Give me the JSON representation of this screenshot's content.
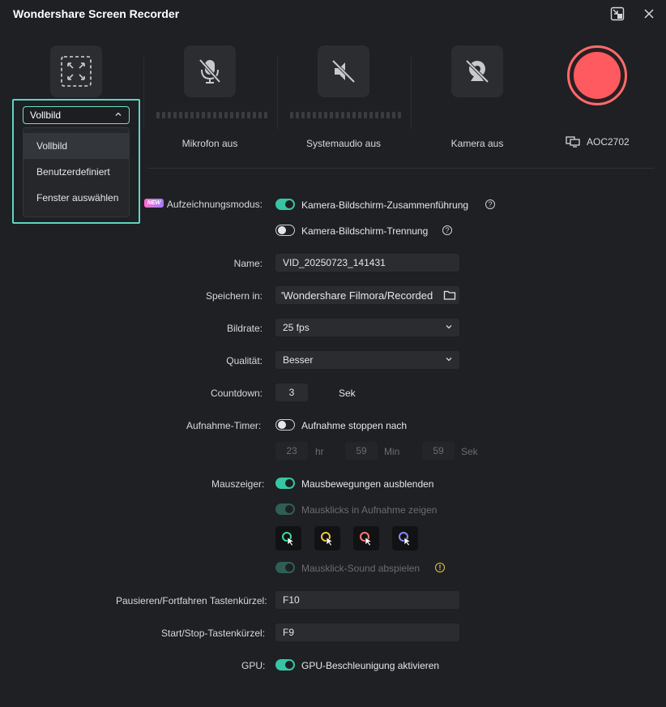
{
  "window": {
    "title": "Wondershare Screen Recorder"
  },
  "sources": {
    "screen": {
      "icon": "fullscreen-icon"
    },
    "microphone": {
      "label": "Mikrofon aus",
      "icon": "mic-off-icon"
    },
    "system_audio": {
      "label": "Systemaudio aus",
      "icon": "speaker-off-icon"
    },
    "camera": {
      "label": "Kamera aus",
      "icon": "camera-off-icon"
    },
    "monitor": {
      "label": "AOC2702",
      "icon": "monitor-icon"
    }
  },
  "area_dropdown": {
    "selected": "Vollbild",
    "options": [
      "Vollbild",
      "Benutzerdefiniert",
      "Fenster auswählen"
    ]
  },
  "settings": {
    "mode": {
      "label": "Aufzeichnungsmodus:",
      "badge": "NEW",
      "option_merge": "Kamera-Bildschirm-Zusammenführung",
      "option_split": "Kamera-Bildschirm-Trennung"
    },
    "name": {
      "label": "Name:",
      "value": "VID_20250723_141431"
    },
    "save": {
      "label": "Speichern in:",
      "value": "'Wondershare Filmora/Recorded"
    },
    "framerate": {
      "label": "Bildrate:",
      "value": "25 fps"
    },
    "quality": {
      "label": "Qualität:",
      "value": "Besser"
    },
    "countdown": {
      "label": "Countdown:",
      "value": "3",
      "unit": "Sek"
    },
    "timer": {
      "label": "Aufnahme-Timer:",
      "toggle_label": "Aufnahme stoppen nach",
      "hours": "23",
      "hours_unit": "hr",
      "minutes": "59",
      "minutes_unit": "Min",
      "seconds": "59",
      "seconds_unit": "Sek"
    },
    "pointer": {
      "label": "Mauszeiger:",
      "hide_moves": "Mausbewegungen ausblenden",
      "show_clicks": "Mausklicks in Aufnahme zeigen",
      "click_sound": "Mausklick-Sound abspielen",
      "cursor_colors": [
        "#3ddc97",
        "#f5c542",
        "#ff7a7a",
        "#8a8cff"
      ]
    },
    "pause_shortcut": {
      "label": "Pausieren/Fortfahren Tastenkürzel:",
      "value": "F10"
    },
    "start_shortcut": {
      "label": "Start/Stop-Tastenkürzel:",
      "value": "F9"
    },
    "gpu": {
      "label": "GPU:",
      "toggle_label": "GPU-Beschleunigung aktivieren"
    }
  },
  "colors": {
    "accent": "#37c6a4",
    "record": "#ff5a5f",
    "background": "#1e2023"
  }
}
